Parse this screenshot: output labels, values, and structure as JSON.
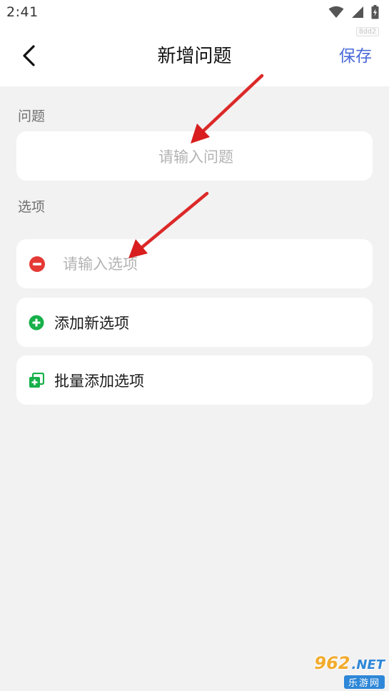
{
  "status_bar": {
    "time": "2:41",
    "icons": [
      "wifi-icon",
      "signal-icon",
      "battery-icon"
    ]
  },
  "tag_badge": "8dd2",
  "header": {
    "back_icon": "chevron-left-icon",
    "title": "新增问题",
    "save_label": "保存"
  },
  "question_section": {
    "label": "问题",
    "placeholder": "请输入问题",
    "value": ""
  },
  "options_section": {
    "label": "选项",
    "options": [
      {
        "placeholder": "请输入选项",
        "value": "",
        "remove_icon": "minus-circle-icon"
      }
    ],
    "add_option_label": "添加新选项",
    "add_option_icon": "plus-circle-icon",
    "bulk_add_label": "批量添加选项",
    "bulk_add_icon": "stacked-plus-icon"
  },
  "watermark": {
    "number": "962",
    "suffix": ".NET",
    "sub": "乐游网"
  },
  "colors": {
    "accent": "#4c6bd8",
    "danger": "#e53935",
    "success": "#17b04a",
    "annotation": "#e02020",
    "background": "#f2f2f2"
  }
}
